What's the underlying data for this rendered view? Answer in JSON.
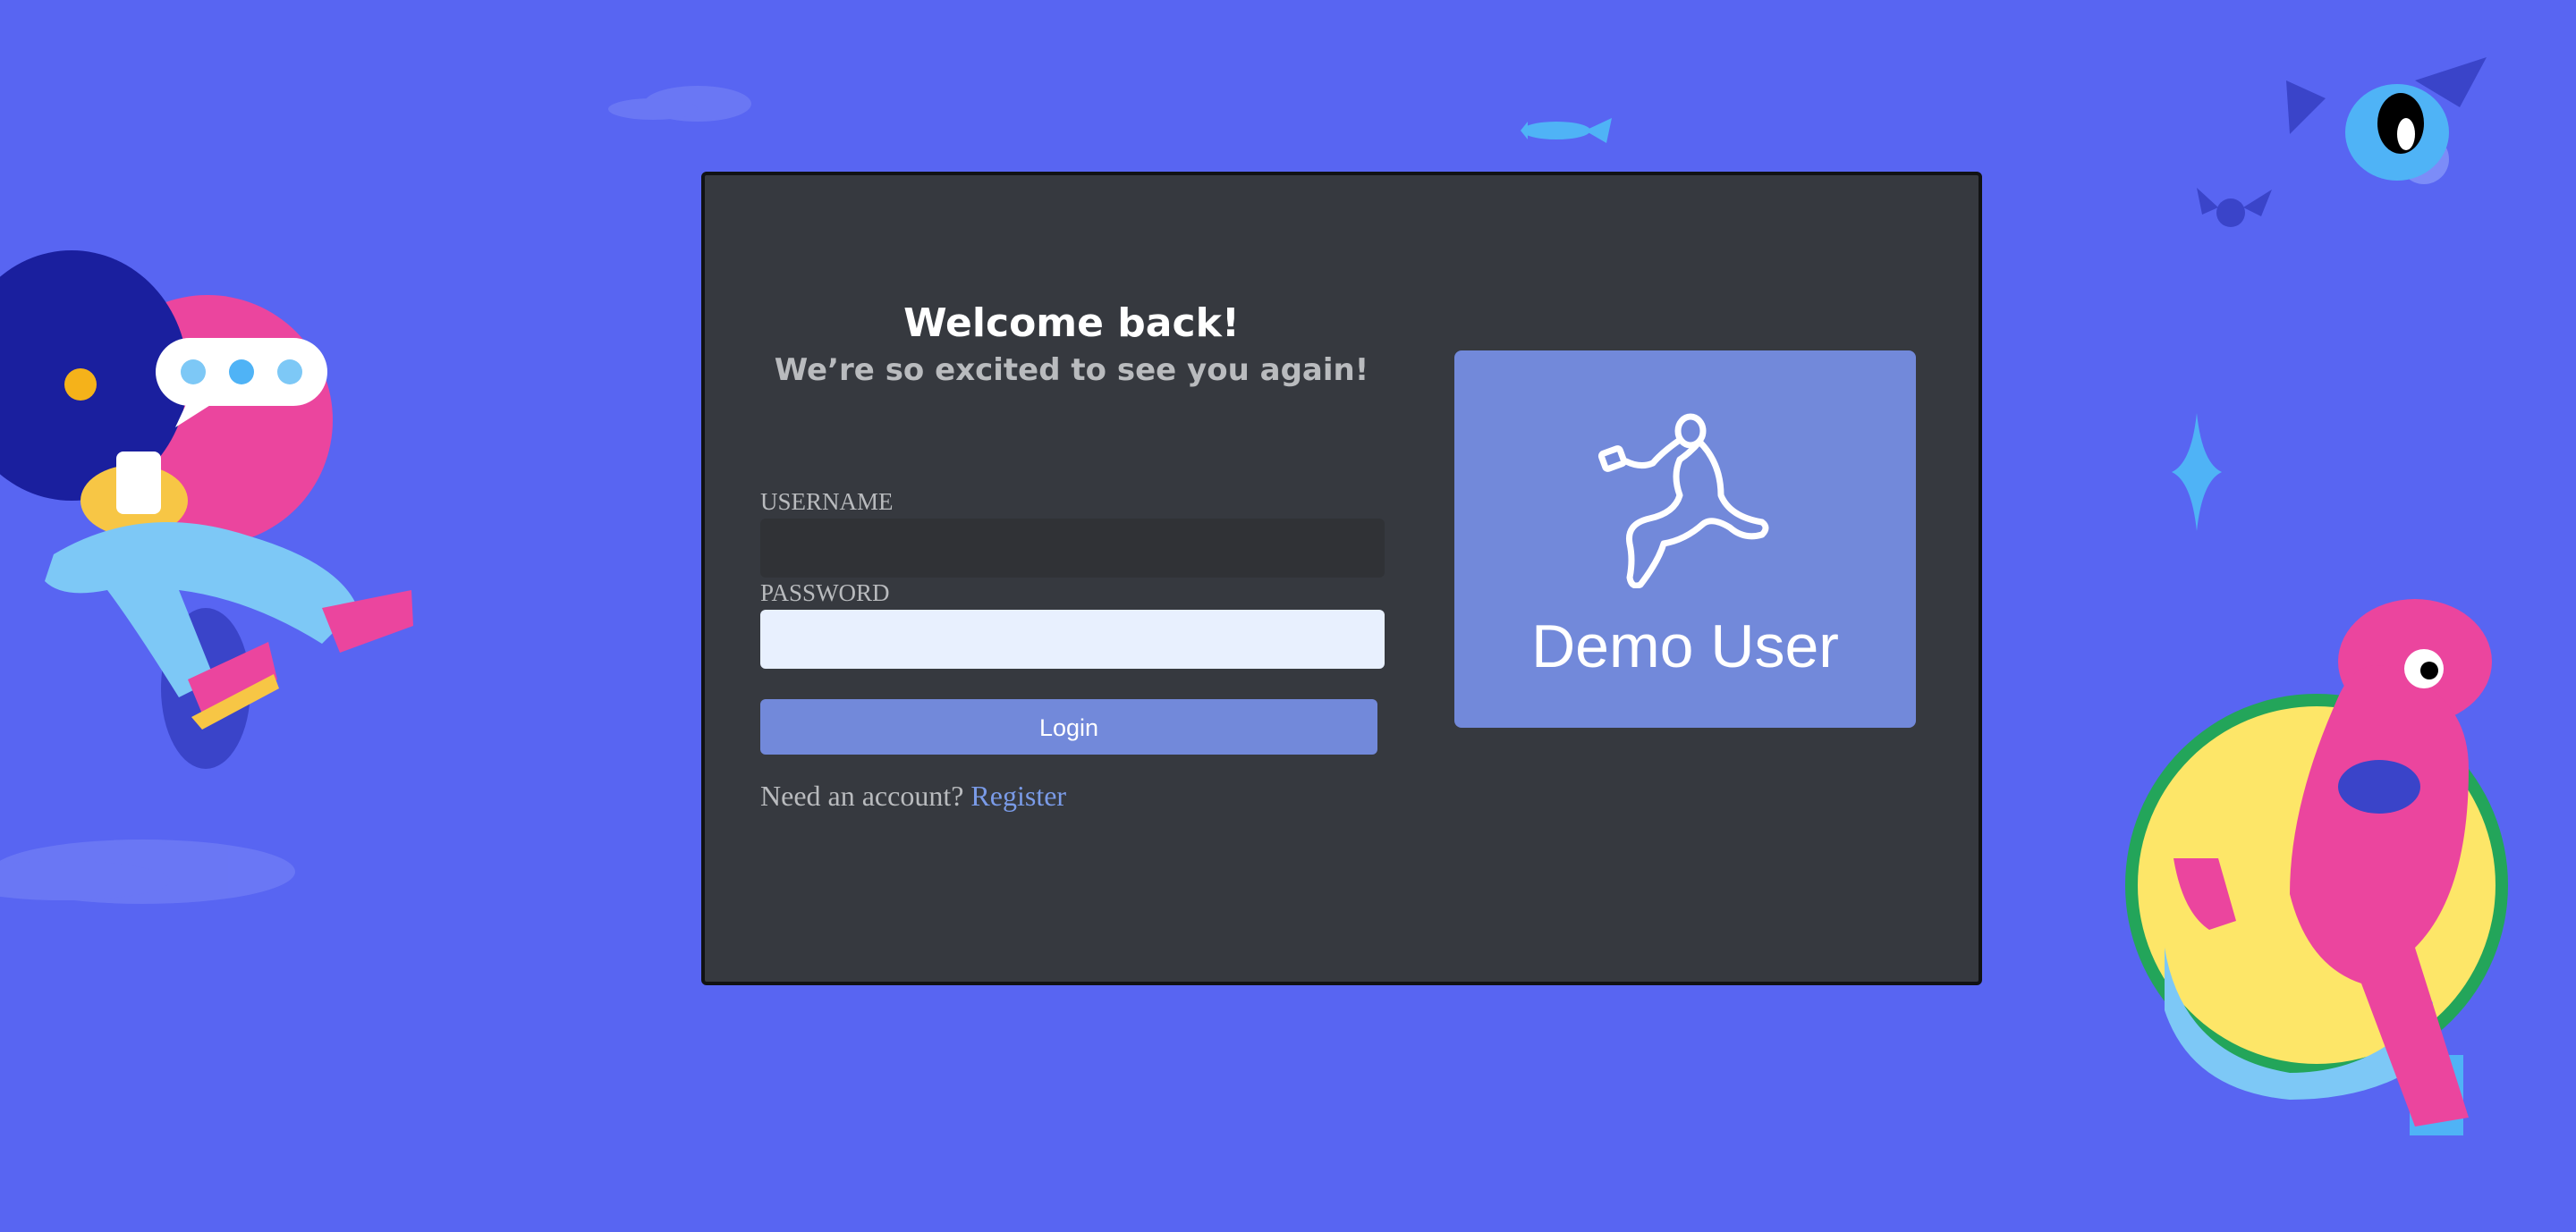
{
  "colors": {
    "background": "#5865f2",
    "card": "#36393f",
    "accent": "#7289da",
    "link": "#7a9be8"
  },
  "login": {
    "title": "Welcome back!",
    "subtitle": "We’re so excited to see you again!",
    "username_label": "USERNAME",
    "username_value": "",
    "password_label": "PASSWORD",
    "password_value": "",
    "login_button": "Login",
    "register_prompt": "Need an account?",
    "register_link": "Register"
  },
  "demo": {
    "label": "Demo User",
    "icon": "dancing-person-icon"
  },
  "decorations": {
    "icons": [
      "cloud-icon",
      "fish-icon",
      "bat-icon",
      "sparkle-icon",
      "chat-bubble-icon",
      "person-on-phone-illustration",
      "pink-creature-illustration",
      "one-eyed-bat-creature-illustration"
    ]
  }
}
